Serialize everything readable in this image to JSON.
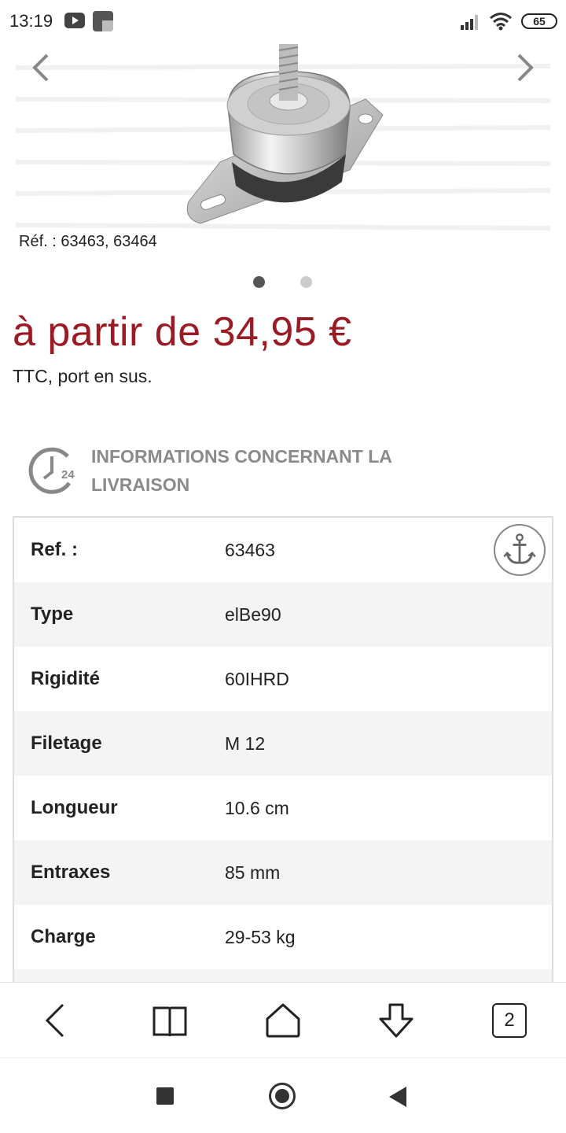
{
  "status_bar": {
    "time": "13:19",
    "battery": "65",
    "icons": [
      "youtube-icon",
      "app-notification-icon",
      "signal-icon",
      "wifi-icon",
      "battery-icon"
    ]
  },
  "gallery": {
    "ref_caption": "Réf. : 63463, 63464",
    "image_subject": "product-image",
    "slide_count": 2,
    "active_slide": 1
  },
  "price": {
    "text": "à partir de 34,95 €",
    "note": "TTC, port en sus.",
    "color": "#9b1b25"
  },
  "delivery": {
    "icon": "24h-delivery-icon",
    "text": "INFORMATIONS CONCERNANT LA LIVRAISON"
  },
  "specs": {
    "rows": [
      {
        "label": "Ref. :",
        "value": "63463"
      },
      {
        "label": "Type",
        "value": "elBe90"
      },
      {
        "label": "Rigidité",
        "value": "60IHRD"
      },
      {
        "label": "Filetage",
        "value": "M 12"
      },
      {
        "label": "Longueur",
        "value": "10.6 cm"
      },
      {
        "label": "Entraxes",
        "value": "85 mm"
      },
      {
        "label": "Charge",
        "value": "29-53 kg"
      }
    ],
    "anchor_icon": "anchor-icon"
  },
  "browser_bar": {
    "tab_count": "2",
    "icons": [
      "back-icon",
      "bookmarks-icon",
      "home-icon",
      "download-icon",
      "tabs-icon"
    ]
  },
  "android_nav": {
    "icons": [
      "recents-icon",
      "home-circle-icon",
      "back-triangle-icon"
    ]
  }
}
